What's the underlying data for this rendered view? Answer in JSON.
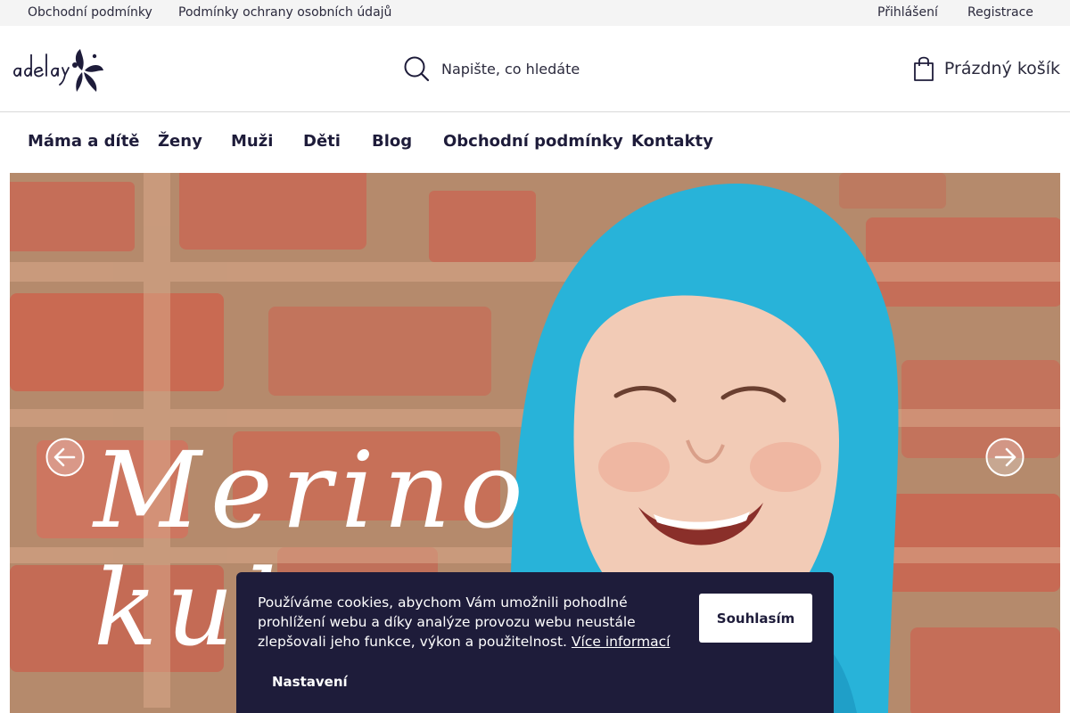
{
  "topbar": {
    "links": [
      "Obchodní podmínky",
      "Podmínky ochrany osobních údajů"
    ],
    "login": "Přihlášení",
    "register": "Registrace"
  },
  "header": {
    "logo_alt": "adelay",
    "search_placeholder": "Napište, co hledáte",
    "cart_label": "Prázdný košík"
  },
  "nav": {
    "items": [
      "Máma a dítě",
      "Ženy",
      "Muži",
      "Děti",
      "Blog",
      "Obchodní podmínky",
      "Kontakty"
    ]
  },
  "hero": {
    "title": "Merino\nkuk"
  },
  "cookie": {
    "text": "Používáme cookies, abychom Vám umožnili pohodlné prohlížení webu a díky analýze provozu webu neustále zlepšovali jeho funkce, výkon a použitelnost.",
    "more_link": "Více informací",
    "agree_button": "Souhlasím",
    "settings_button": "Nastavení"
  },
  "colors": {
    "brand_dark": "#1e1c3a",
    "topbar_bg": "#f4f4f4",
    "hood_blue": "#28b3d9"
  }
}
